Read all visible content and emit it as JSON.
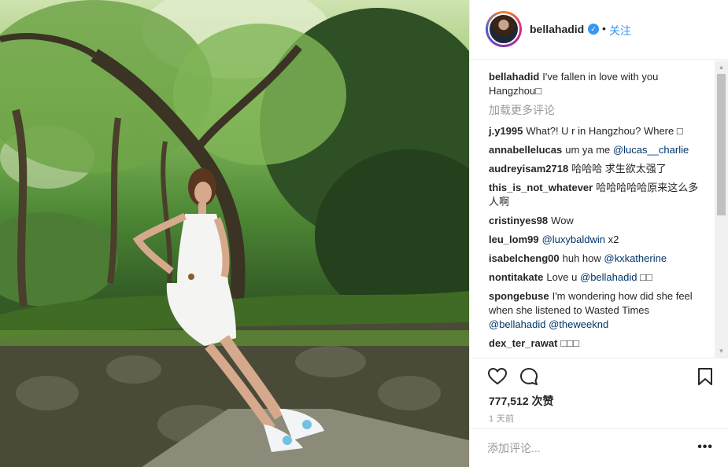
{
  "header": {
    "username": "bellahadid",
    "verified_icon": "verified-badge-icon",
    "separator": "•",
    "follow_label": "关注"
  },
  "caption": {
    "username": "bellahadid",
    "text": "I've fallen in love with you Hangzhou□"
  },
  "load_more_label": "加载更多评论",
  "comments": [
    {
      "username": "j.y1995",
      "text": "What?! U r in Hangzhou? Where □"
    },
    {
      "username": "annabellelucas",
      "text": "um ya me ",
      "mention": "@lucas__charlie"
    },
    {
      "username": "audreyisam2718",
      "text": "哈哈哈 求生欲太强了"
    },
    {
      "username": "this_is_not_whatever",
      "text": "哈哈哈哈哈原来这么多人啊"
    },
    {
      "username": "cristinyes98",
      "text": "Wow"
    },
    {
      "username": "leu_lom99",
      "text": "",
      "mention": "@luxybaldwin",
      "after": " x2"
    },
    {
      "username": "isabelcheng00",
      "text": "huh how ",
      "mention": "@kxkatherine"
    },
    {
      "username": "nontitakate",
      "text": "Love u ",
      "mention": "@bellahadid",
      "after": " □□"
    },
    {
      "username": "spongebuse",
      "text": "I'm wondering how did she feel when she listened to Wasted Times ",
      "mention": "@bellahadid",
      "after": " ",
      "mention2": "@theweeknd"
    },
    {
      "username": "dex_ter_rawat",
      "text": "□□□"
    }
  ],
  "actions": {
    "like_icon": "heart-icon",
    "comment_icon": "comment-bubble-icon",
    "save_icon": "bookmark-icon",
    "likes_text": "777,512 次赞",
    "timestamp": "1 天前"
  },
  "add_comment": {
    "placeholder": "添加评论...",
    "more_label": "•••"
  }
}
